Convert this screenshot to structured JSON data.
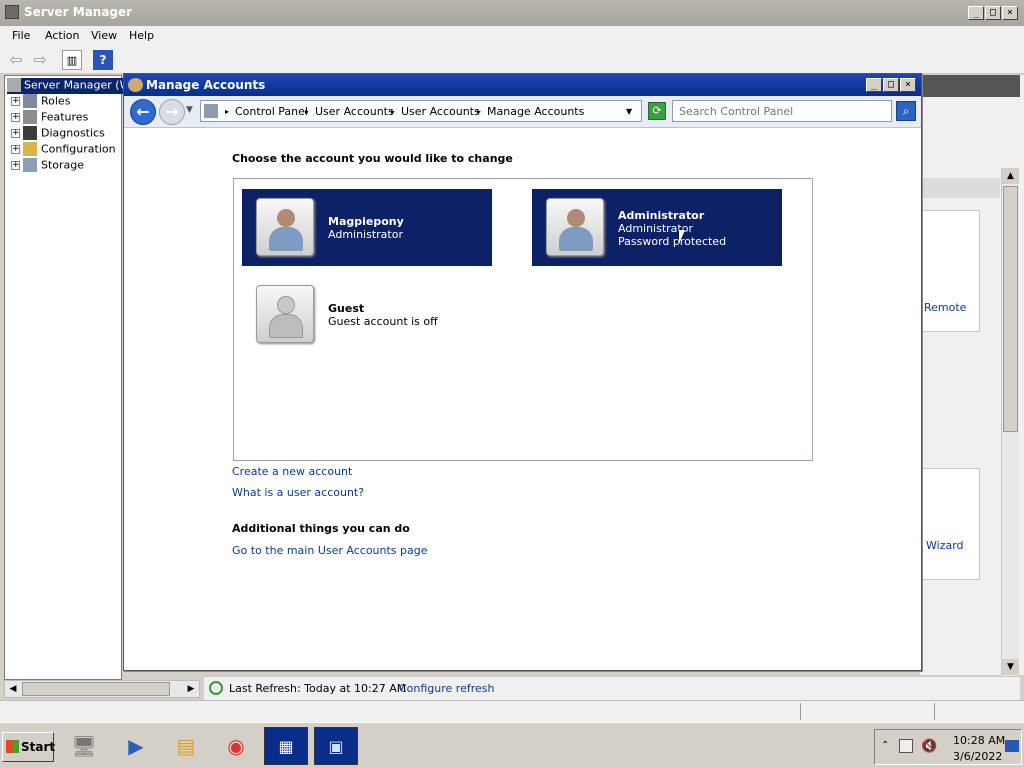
{
  "server_manager": {
    "title": "Server Manager",
    "menu": [
      "File",
      "Action",
      "View",
      "Help"
    ],
    "tree_root": "Server Manager (W",
    "tree_items": [
      "Roles",
      "Features",
      "Diagnostics",
      "Configuration",
      "Storage"
    ],
    "right_links": [
      "Remote",
      "Wizard"
    ],
    "status": {
      "refresh_text": "Last Refresh: Today at 10:27 AM",
      "configure_link": "Configure refresh"
    }
  },
  "dialog": {
    "title": "Manage Accounts",
    "breadcrumbs": [
      "Control Panel",
      "User Accounts",
      "User Accounts",
      "Manage Accounts"
    ],
    "search_placeholder": "Search Control Panel",
    "heading": "Choose the account you would like to change",
    "accounts": [
      {
        "name": "Magpiepony",
        "line1": "Administrator",
        "line2": ""
      },
      {
        "name": "Administrator",
        "line1": "Administrator",
        "line2": "Password protected"
      },
      {
        "name": "Guest",
        "line1": "Guest account is off",
        "line2": ""
      }
    ],
    "links": [
      "Create a new account",
      "What is a user account?"
    ],
    "additional_heading": "Additional things you can do",
    "additional_links": [
      "Go to the main User Accounts page"
    ]
  },
  "taskbar": {
    "start_label": "Start",
    "time": "10:28 AM",
    "date": "3/6/2022"
  }
}
